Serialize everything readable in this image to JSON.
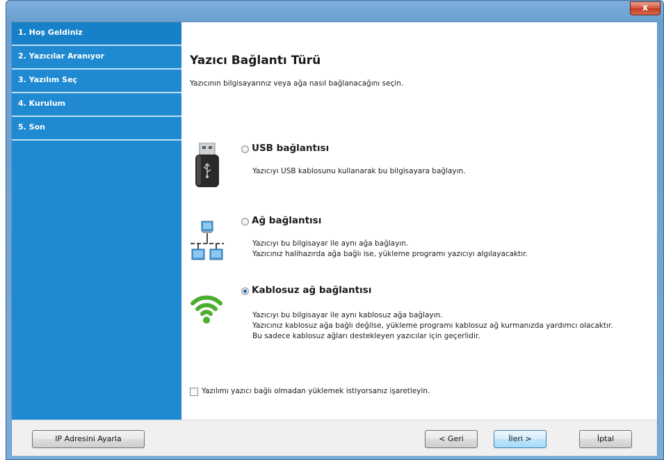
{
  "window": {
    "close_label": "x"
  },
  "sidebar": {
    "steps": [
      {
        "label": "1. Hoş Geldiniz"
      },
      {
        "label": "2. Yazıcılar Aranıyor"
      },
      {
        "label": "3. Yazılım Seç"
      },
      {
        "label": "4. Kurulum"
      },
      {
        "label": "5. Son"
      }
    ]
  },
  "main": {
    "title": "Yazıcı Bağlantı Türü",
    "subtitle": "Yazıcının bilgisayarınız veya ağa nasıl bağlanacağını seçin.",
    "options": [
      {
        "title": "USB bağlantısı",
        "icon": "usb-drive-icon",
        "selected": false,
        "lines": [
          "Yazıcıyı USB kablosunu kullanarak bu bilgisayara bağlayın."
        ]
      },
      {
        "title": "Ağ bağlantısı",
        "icon": "network-icon",
        "selected": false,
        "lines": [
          "Yazıcıyı bu bilgisayar ile aynı ağa bağlayın.",
          "Yazıcınız halihazırda ağa bağlı ise, yükleme programı yazıcıyı algılayacaktır."
        ]
      },
      {
        "title": "Kablosuz ağ bağlantısı",
        "icon": "wifi-icon",
        "selected": true,
        "lines": [
          "Yazıcıyı bu bilgisayar ile aynı kablosuz ağa bağlayın.",
          "Yazıcınız kablosuz ağa bağlı değilse, yükleme programı kablosuz ağ kurmanızda yardımcı olacaktır.",
          "Bu sadece kablosuz ağları destekleyen yazıcılar için geçerlidir."
        ]
      }
    ],
    "checkbox_label": "Yazılımı yazıcı bağlı olmadan yüklemek istiyorsanız işaretleyin.",
    "checkbox_checked": false
  },
  "footer": {
    "ip_button": "IP Adresini Ayarla",
    "back_button": "< Geri",
    "next_button": "İleri >",
    "cancel_button": "İptal"
  },
  "colors": {
    "sidebar": "#1f8ad1",
    "accent": "#1c5fb4",
    "wifi_green": "#4cae2f"
  }
}
